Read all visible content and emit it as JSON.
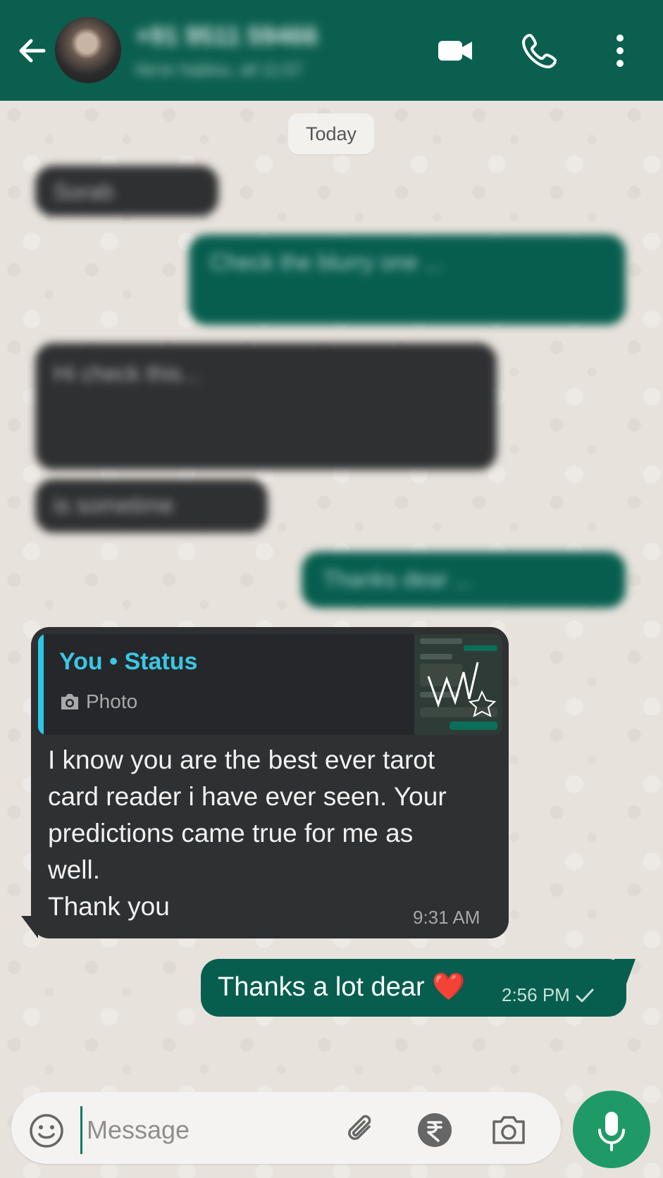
{
  "header": {
    "contact_name": "+91 9511 59466",
    "contact_status": "Ne'er hablou, all 11:57"
  },
  "chat": {
    "date_label": "Today",
    "blurred_messages": [
      {
        "direction": "in",
        "text": "Sorab"
      },
      {
        "direction": "out",
        "text": "Check the blurry one ..."
      },
      {
        "direction": "in",
        "text": "Hi check this..."
      },
      {
        "direction": "in",
        "text": "is sometime"
      },
      {
        "direction": "out",
        "text": "Thanks dear ..."
      }
    ],
    "reply_message": {
      "quoted_title": "You • Status",
      "quoted_type": "Photo",
      "text": "I know you are the best ever tarot\ncard reader i have ever seen. Your\npredictions came true for me as\nwell.\nThank you",
      "time": "9:31 AM"
    },
    "sent_message": {
      "text": "Thanks a lot dear ❤️",
      "time": "2:56 PM",
      "status_icon": "single-check-icon"
    }
  },
  "composer": {
    "placeholder": "Message"
  },
  "colors": {
    "header_bg": "#0b5f4f",
    "outgoing_bubble": "#075e4f",
    "incoming_bubble": "#2f3032",
    "quote_accent": "#2ec8e6",
    "mic_button": "#1f9a66"
  }
}
